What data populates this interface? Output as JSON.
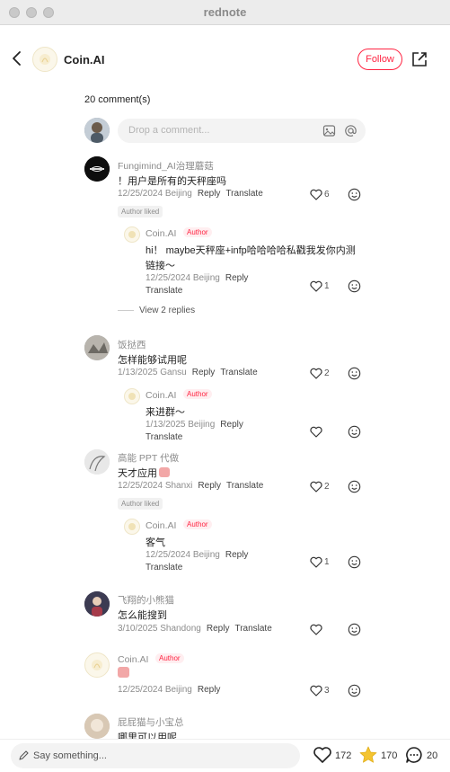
{
  "window": {
    "title": "rednote"
  },
  "header": {
    "name": "Coin.AI",
    "follow_label": "Follow"
  },
  "comments_count": "20 comment(s)",
  "composer": {
    "placeholder": "Drop a comment..."
  },
  "comments": [
    {
      "user": "Fungimind_AI治理蘑菇",
      "text": "！用户是所有的天秤座吗",
      "date_loc": "12/25/2024 Beijing",
      "reply": "Reply",
      "translate": "Translate",
      "likes": "6",
      "badge": "Author liked",
      "replies": [
        {
          "user": "Coin.AI",
          "author_tag": "Author",
          "text_line1": "hi！ maybe天秤座+infp哈哈哈哈私戳我发你内测",
          "text_line2": "链接～",
          "date_loc": "12/25/2024 Beijing",
          "reply": "Reply",
          "translate": "Translate",
          "likes": "1"
        }
      ],
      "view_more": "View 2 replies"
    },
    {
      "user": "饭挞西",
      "text": "怎样能够试用呢",
      "date_loc": "1/13/2025 Gansu",
      "reply": "Reply",
      "translate": "Translate",
      "likes": "2",
      "replies": [
        {
          "user": "Coin.AI",
          "author_tag": "Author",
          "text": "来进群～",
          "date_loc": "1/13/2025 Beijing",
          "reply": "Reply",
          "translate": "Translate",
          "likes": ""
        }
      ]
    },
    {
      "user": "高能 PPT 代做",
      "text": "天才应用",
      "date_loc": "12/25/2024 Shanxi",
      "reply": "Reply",
      "translate": "Translate",
      "likes": "2",
      "badge": "Author liked",
      "replies": [
        {
          "user": "Coin.AI",
          "author_tag": "Author",
          "text": "客气",
          "date_loc": "12/25/2024 Beijing",
          "reply": "Reply",
          "translate": "Translate",
          "likes": "1"
        }
      ]
    },
    {
      "user": "飞翔的小熊猫",
      "text": "怎么能搜到",
      "date_loc": "3/10/2025 Shandong",
      "reply": "Reply",
      "translate": "Translate",
      "likes": ""
    },
    {
      "user": "Coin.AI",
      "author_tag": "Author",
      "text": "",
      "date_loc": "12/25/2024 Beijing",
      "reply": "Reply",
      "likes": "3"
    },
    {
      "user": "屁屁猫与小宝总",
      "text": "哪里可以用呢"
    }
  ],
  "bottom": {
    "placeholder": "Say something...",
    "likes": "172",
    "collects": "170",
    "comments": "20"
  },
  "colors": {
    "accent": "#ff2442",
    "collect": "#f4c430"
  },
  "icons": [
    "back-icon",
    "share-icon",
    "image-icon",
    "at-icon",
    "heart-icon",
    "smile-icon",
    "pen-icon",
    "star-icon",
    "comment-bubble-icon"
  ]
}
